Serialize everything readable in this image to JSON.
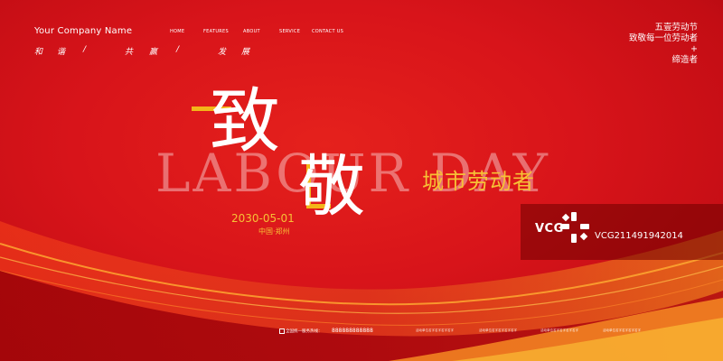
{
  "company_name": "Your Company Name",
  "slogan": [
    "和",
    "谐",
    "/",
    "共",
    "赢",
    "/",
    "发",
    "展"
  ],
  "nav": [
    "HOME",
    "FEATURES",
    "ABOUT",
    "SERVICE",
    "CONTACT US"
  ],
  "right_note": [
    "五壹劳动节",
    "致敬每一位劳动者",
    "+",
    "缔造者"
  ],
  "headline_en": "LABOUR DAY",
  "headline_char_1": "致",
  "headline_char_2": "敬",
  "subtitle": "城市劳动者",
  "date": "2030-05-01",
  "place": "中国·郑州",
  "watermark": {
    "logo_text": "VCG",
    "image_id": "VCG211491942014"
  },
  "footer": {
    "hotline_label": "全国统一服务热线：",
    "phone": "888888888888",
    "items": [
      "活动单位名字名字名字名字",
      "活动单位名字名字名字名字",
      "活动单位名字名字名字名字",
      "活动单位名字名字名字名字"
    ]
  },
  "colors": {
    "background": "#d8141a",
    "accent": "#f3b519"
  }
}
